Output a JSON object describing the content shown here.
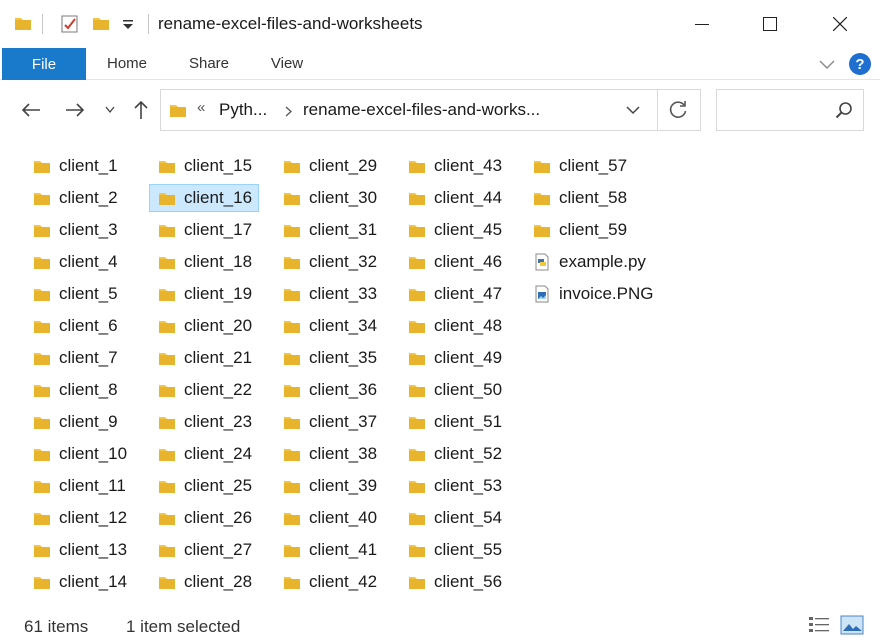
{
  "window": {
    "title": "rename-excel-files-and-worksheets",
    "controls": {
      "minimize_icon": "minimize-icon",
      "maximize_icon": "maximize-icon",
      "close_icon": "close-icon"
    }
  },
  "ribbon": {
    "tabs": [
      {
        "label": "File",
        "active": true
      },
      {
        "label": "Home"
      },
      {
        "label": "Share"
      },
      {
        "label": "View"
      }
    ],
    "help_label": "?"
  },
  "address": {
    "crumbs": [
      "Pyth...",
      "rename-excel-files-and-works..."
    ],
    "overflow_label": "«"
  },
  "files": {
    "columns": [
      [
        "client_1",
        "client_2",
        "client_3",
        "client_4",
        "client_5",
        "client_6",
        "client_7",
        "client_8",
        "client_9",
        "client_10",
        "client_11",
        "client_12",
        "client_13",
        "client_14"
      ],
      [
        "client_15",
        "client_16",
        "client_17",
        "client_18",
        "client_19",
        "client_20",
        "client_21",
        "client_22",
        "client_23",
        "client_24",
        "client_25",
        "client_26",
        "client_27",
        "client_28"
      ],
      [
        "client_29",
        "client_30",
        "client_31",
        "client_32",
        "client_33",
        "client_34",
        "client_35",
        "client_36",
        "client_37",
        "client_38",
        "client_39",
        "client_40",
        "client_41",
        "client_42"
      ],
      [
        "client_43",
        "client_44",
        "client_45",
        "client_46",
        "client_47",
        "client_48",
        "client_49",
        "client_50",
        "client_51",
        "client_52",
        "client_53",
        "client_54",
        "client_55",
        "client_56"
      ],
      [
        "client_57",
        "client_58",
        "client_59",
        "example.py",
        "invoice.PNG"
      ]
    ],
    "selected": "client_16"
  },
  "status": {
    "item_count": "61 items",
    "selection": "1 item selected"
  },
  "colors": {
    "accent": "#1979ca",
    "folder": "#f4c542",
    "selection": "#cce8ff"
  }
}
